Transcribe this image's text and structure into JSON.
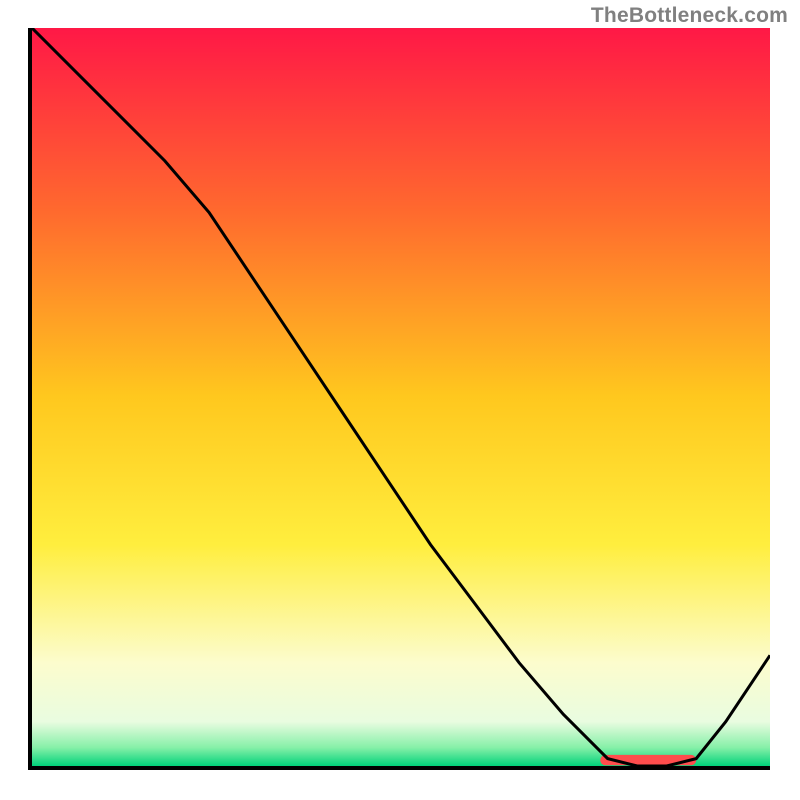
{
  "watermark": "TheBottleneck.com",
  "chart_data": {
    "type": "line",
    "title": "",
    "xlabel": "",
    "ylabel": "",
    "xlim": [
      0,
      100
    ],
    "ylim": [
      0,
      100
    ],
    "grid": false,
    "legend": false,
    "gradient_stops": [
      {
        "offset": 0,
        "color": "#ff1846"
      },
      {
        "offset": 0.25,
        "color": "#ff6a2e"
      },
      {
        "offset": 0.5,
        "color": "#ffc81e"
      },
      {
        "offset": 0.7,
        "color": "#ffee3e"
      },
      {
        "offset": 0.86,
        "color": "#fcfccd"
      },
      {
        "offset": 0.94,
        "color": "#e9fce0"
      },
      {
        "offset": 0.975,
        "color": "#86f0a8"
      },
      {
        "offset": 1.0,
        "color": "#00d27a"
      }
    ],
    "series": [
      {
        "name": "curve",
        "color": "#000000",
        "x": [
          0,
          6,
          12,
          18,
          24,
          30,
          36,
          42,
          48,
          54,
          60,
          66,
          72,
          78,
          82,
          86,
          90,
          94,
          100
        ],
        "y": [
          100,
          94,
          88,
          82,
          75,
          66,
          57,
          48,
          39,
          30,
          22,
          14,
          7,
          1,
          0,
          0,
          1,
          6,
          15
        ]
      }
    ],
    "markers": [
      {
        "name": "optimum-band",
        "color": "#ff4d4d",
        "x_start": 77,
        "x_end": 90,
        "y": 0.8,
        "height": 1.4
      }
    ]
  }
}
